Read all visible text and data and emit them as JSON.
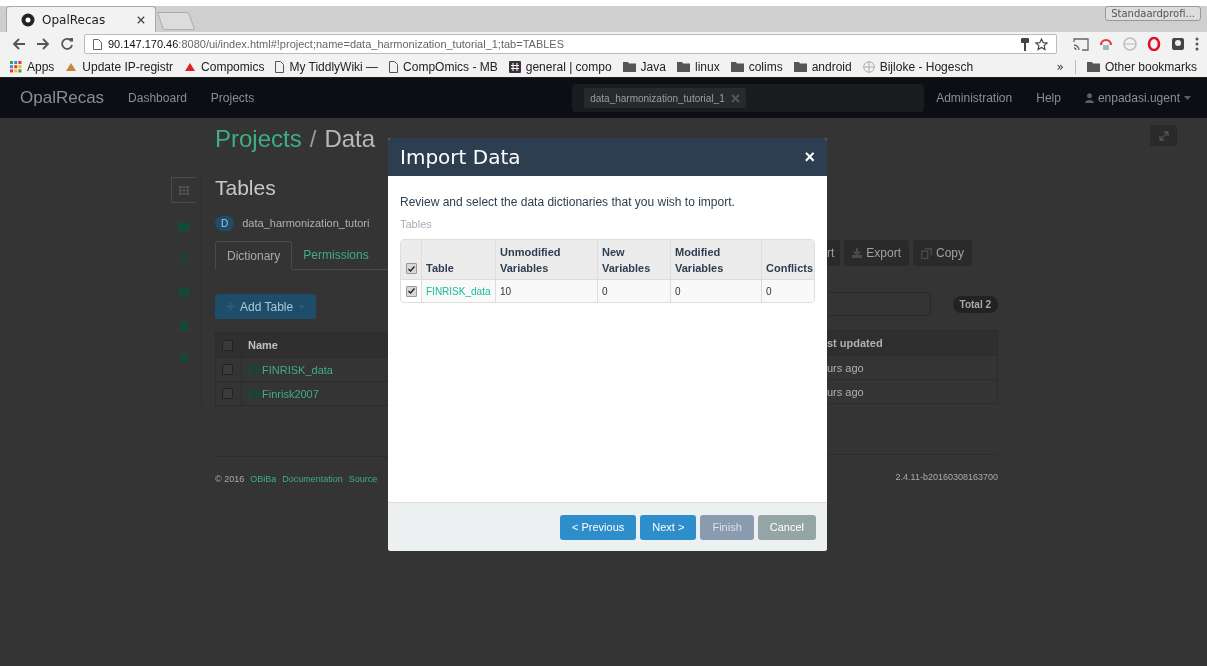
{
  "browser": {
    "tab_title": "OpalRecas",
    "profile": "Standaardprofi...",
    "url_host": "90.147.170.46",
    "url_rest": ":8080/ui/index.html#!project;name=data_harmonization_tutorial_1;tab=TABLES",
    "bookmarks": [
      {
        "kind": "apps",
        "label": "Apps"
      },
      {
        "kind": "logo",
        "label": "Update IP-registr"
      },
      {
        "kind": "logo",
        "label": "Compomics"
      },
      {
        "kind": "page",
        "label": "My TiddlyWiki —"
      },
      {
        "kind": "page",
        "label": "CompOmics - MB"
      },
      {
        "kind": "hash",
        "label": "general | compo"
      },
      {
        "kind": "folder",
        "label": "Java"
      },
      {
        "kind": "folder",
        "label": "linux"
      },
      {
        "kind": "folder",
        "label": "colims"
      },
      {
        "kind": "folder",
        "label": "android"
      },
      {
        "kind": "globe",
        "label": "Bijloke - Hogesch"
      }
    ],
    "overflow": "»",
    "other_bookmarks": "Other bookmarks"
  },
  "navbar": {
    "brand": "OpalRecas",
    "links": [
      "Dashboard",
      "Projects"
    ],
    "search_chip": "data_harmonization_tutorial_1",
    "links_right": [
      "Administration",
      "Help"
    ],
    "user": "enpadasi.ugent"
  },
  "page": {
    "sidebar": [
      {
        "selected": true
      },
      {
        "selected": false
      },
      {
        "selected": false
      },
      {
        "selected": false
      },
      {
        "selected": false
      },
      {
        "selected": false
      }
    ],
    "breadcrumb": "Projects",
    "separator": "/",
    "title": "Data",
    "heading": "Tables",
    "badge": "D",
    "project_name": "data_harmonization_tutori",
    "tabs": [
      {
        "label": "Dictionary",
        "selected": true
      },
      {
        "label": "Permissions",
        "selected": false
      }
    ],
    "add_button": "Add Table",
    "right_buttons": [
      "rt",
      "Export",
      "Copy"
    ],
    "total": "Total 2",
    "table": {
      "header_left": "Name",
      "header_right": "st updated",
      "all_checked": false,
      "rows": [
        {
          "name": "FINRISK_data",
          "updated": "urs ago",
          "checked": false
        },
        {
          "name": "Finrisk2007",
          "updated": "urs ago",
          "checked": false
        }
      ]
    },
    "footer": {
      "copyright": "© 2016",
      "links": [
        "OBiBa",
        "Documentation",
        "Source"
      ],
      "version": "2.4.11-b20160308163700"
    }
  },
  "modal": {
    "title": "Import Data",
    "close": "×",
    "intro": "Review and select the data dictionaries that you wish to import.",
    "section_label": "Tables",
    "columns": [
      "Table",
      "Unmodified Variables",
      "New Variables",
      "Modified Variables",
      "Conflicts"
    ],
    "all_checked": true,
    "rows": [
      {
        "checked": true,
        "cells": [
          "FINRISK_data",
          "10",
          "0",
          "0",
          "0"
        ]
      }
    ],
    "buttons": [
      {
        "label": "< Previous",
        "kind": "primary"
      },
      {
        "label": "Next >",
        "kind": "primary"
      },
      {
        "label": "Finish",
        "kind": "disabled"
      },
      {
        "label": "Cancel",
        "kind": "default"
      }
    ]
  }
}
